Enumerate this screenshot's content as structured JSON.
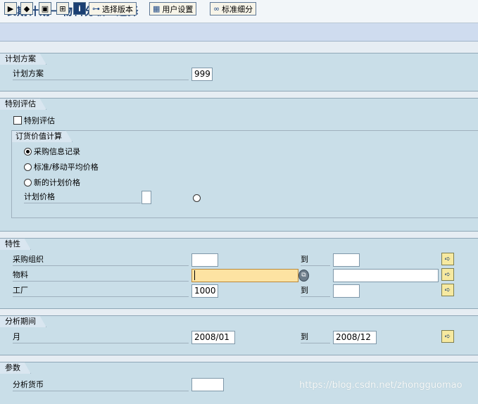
{
  "title": "长期计划一物料分析: 选择",
  "toolbar": {
    "icons": [
      "execute-icon",
      "get-variant-icon",
      "save-variant-icon",
      "selection-options-icon",
      "info-icon"
    ],
    "select_version_label": "选择版本",
    "user_settings_label": "用户设置",
    "standard_drilldown_label": "标准细分"
  },
  "plan_scenario": {
    "tab": "计划方案",
    "label": "计划方案",
    "value": "999"
  },
  "special_eval": {
    "tab": "特别评估",
    "checkbox_label": "特别评估",
    "checked": false,
    "group_tab": "订货价值计算",
    "options": [
      {
        "label": "采购信息记录",
        "selected": true
      },
      {
        "label": "标准/移动平均价格",
        "selected": false
      },
      {
        "label": "新的计划价格",
        "selected": false
      }
    ],
    "plan_price_label": "计划价格",
    "plan_price_value": ""
  },
  "characteristics": {
    "tab": "特性",
    "to_label": "到",
    "rows": [
      {
        "label": "采购组织",
        "from": "",
        "to": ""
      },
      {
        "label": "物料",
        "from": "",
        "to": ""
      },
      {
        "label": "工厂",
        "from": "1000",
        "to": ""
      }
    ]
  },
  "analysis_period": {
    "tab": "分析期间",
    "label": "月",
    "from": "2008/01",
    "to_label": "到",
    "to": "2008/12"
  },
  "params": {
    "tab": "参数",
    "currency_label": "分析货币",
    "currency_value": ""
  },
  "watermark": "https://blog.csdn.net/zhongguomao"
}
